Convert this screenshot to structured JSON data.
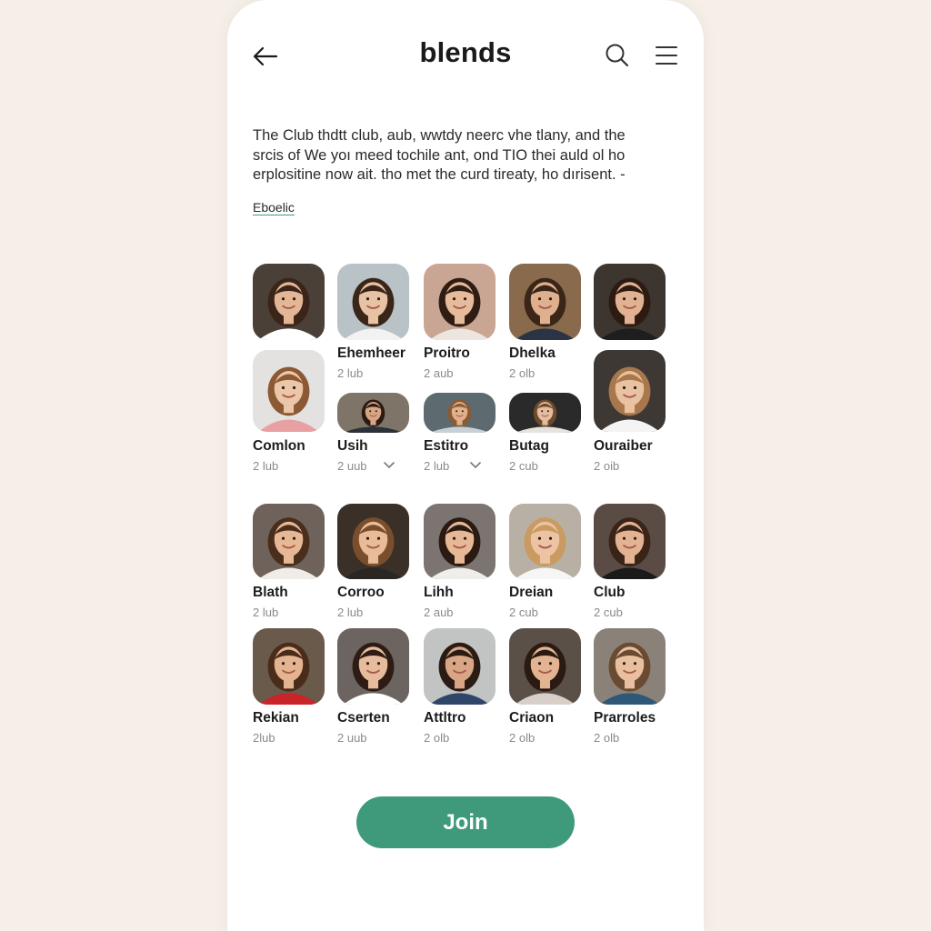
{
  "header": {
    "back_icon": "arrow-left-icon",
    "title": "blends",
    "search_icon": "search-icon",
    "menu_icon": "hamburger-menu-icon"
  },
  "description": {
    "line1": "The Club thdtt club, aub, wwtdy neerc vhe tlany, and the",
    "line2": "srcis of We yoı meed tochile ant, ond TIO thei auld ol ho",
    "line3": "erplositine now ait. tho met the curd tireaty, ho dırisent. -",
    "link": "Eboelic"
  },
  "members": [
    {
      "name": "",
      "sub": "",
      "skin": "#e3b796",
      "hair": "#3b2418",
      "shirt": "#ffffff",
      "bg": "#4a4038"
    },
    {
      "name": "Ehemheer",
      "sub": "2 lub",
      "skin": "#e8c2a4",
      "hair": "#3a2618",
      "shirt": "#f2f2f2",
      "bg": "#b9c2c6"
    },
    {
      "name": "Proitro",
      "sub": "2 aub",
      "skin": "#e6bb9c",
      "hair": "#2f1d14",
      "shirt": "#ece6de",
      "bg": "#c9a594"
    },
    {
      "name": "Dhelka",
      "sub": "2 olb",
      "skin": "#deb08e",
      "hair": "#3a2517",
      "shirt": "#2a3444",
      "bg": "#8a6a4c"
    },
    {
      "name": "",
      "sub": "",
      "skin": "#e0b292",
      "hair": "#2d1b12",
      "shirt": "#1e1e1e",
      "bg": "#3c3530"
    },
    {
      "name": "Comlon",
      "sub": "2 lub",
      "skin": "#ecc6a8",
      "hair": "#8b5a34",
      "shirt": "#e8a0a2",
      "bg": "#e4e2e0"
    },
    {
      "name": "Usih",
      "sub": "2 uub",
      "skin": "#d6a584",
      "hair": "#2a1a12",
      "shirt": "#2c3038",
      "bg": "#7f7468",
      "chev": true
    },
    {
      "name": "Estitro",
      "sub": "2 lub",
      "skin": "#e1b08c",
      "hair": "#8a5a34",
      "shirt": "#c8d0d6",
      "bg": "#5d6a70",
      "chev": true
    },
    {
      "name": "Butag",
      "sub": "2 cub",
      "skin": "#e4bca0",
      "hair": "#6e4a2c",
      "shirt": "#e8e2dc",
      "bg": "#2a2a2a"
    },
    {
      "name": "Ouraiber",
      "sub": "2 oib",
      "skin": "#e9c2a2",
      "hair": "#a8784c",
      "shirt": "#f4f4f4",
      "bg": "#3e3834"
    },
    {
      "name": "Blath",
      "sub": "2 lub",
      "skin": "#e6b896",
      "hair": "#4a2e1c",
      "shirt": "#f0ece8",
      "bg": "#6e625a"
    },
    {
      "name": "Corroo",
      "sub": "2 lub",
      "skin": "#e8bc98",
      "hair": "#7a4e2c",
      "shirt": "#2a2624",
      "bg": "#3a3028"
    },
    {
      "name": "Lihh",
      "sub": "2 aub",
      "skin": "#e6b896",
      "hair": "#2a1a12",
      "shirt": "#f0eeea",
      "bg": "#7c7470"
    },
    {
      "name": "Dreian",
      "sub": "2 cub",
      "skin": "#ecc4a4",
      "hair": "#c99a62",
      "shirt": "#f6f6f4",
      "bg": "#b8b0a4"
    },
    {
      "name": "Club",
      "sub": "2 cub",
      "skin": "#e2b292",
      "hair": "#3a2418",
      "shirt": "#1a1a1a",
      "bg": "#5a4c44"
    },
    {
      "name": "Rekian",
      "sub": "2lub",
      "skin": "#e4b490",
      "hair": "#4a2c1a",
      "shirt": "#c8242a",
      "bg": "#6a5a4c"
    },
    {
      "name": "Cserten",
      "sub": "2 uub",
      "skin": "#e6bc9c",
      "hair": "#2e1c14",
      "shirt": "#ffffff",
      "bg": "#6c6460"
    },
    {
      "name": "Attltro",
      "sub": "2 olb",
      "skin": "#d8a684",
      "hair": "#2a1c14",
      "shirt": "#2e4668",
      "bg": "#c2c4c4"
    },
    {
      "name": "Criaon",
      "sub": "2 olb",
      "skin": "#e2b492",
      "hair": "#2a1a12",
      "shirt": "#d8d0c8",
      "bg": "#5a5048"
    },
    {
      "name": "Prarroles",
      "sub": "2 olb",
      "skin": "#e8c0a0",
      "hair": "#6a4a30",
      "shirt": "#2e5878",
      "bg": "#8a8278"
    }
  ],
  "join_button": {
    "label": "Join",
    "color": "#3f9a7c"
  },
  "colors": {
    "background": "#f5efe8",
    "panel": "#ffffff",
    "accent": "#3f9a7c"
  }
}
